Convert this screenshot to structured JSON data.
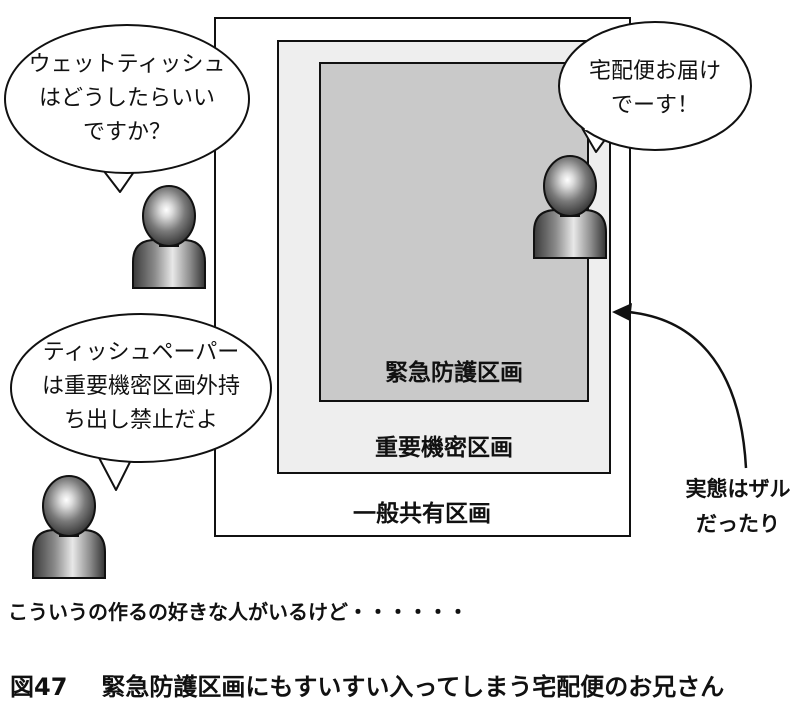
{
  "zones": {
    "outer_label": "一般共有区画",
    "middle_label": "重要機密区画",
    "inner_label": "緊急防護区画"
  },
  "speech": {
    "bubble1_lines": [
      "ウェットティッシュ",
      "はどうしたらいい",
      "ですか？"
    ],
    "bubble2_lines": [
      "宅配便お届け",
      "でーす！"
    ],
    "bubble3_lines": [
      "ティッシュペーパー",
      "は重要機密区画外持",
      "ち出し禁止だよ"
    ]
  },
  "annotation": {
    "lines": [
      "実態はザル",
      "だったり"
    ]
  },
  "bottom_text": "こういうの作るの好きな人がいるけど・・・・・・",
  "caption": {
    "number": "図47",
    "title": "緊急防護区画にもすいすい入ってしまう宅配便のお兄さん"
  },
  "colors": {
    "outer_fill": "#ffffff",
    "middle_fill": "#eeeeee",
    "inner_fill": "#c9c9c9",
    "stroke": "#111111"
  }
}
